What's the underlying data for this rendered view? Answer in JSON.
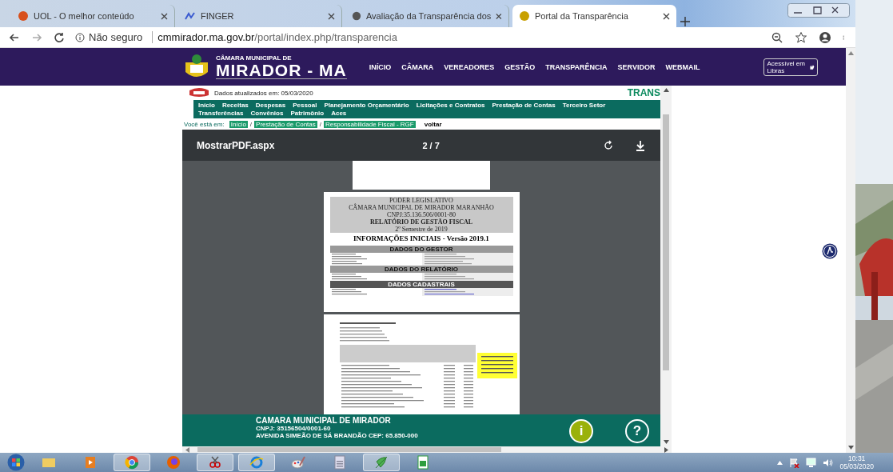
{
  "browser": {
    "tabs": [
      {
        "title": "UOL - O melhor conteúdo",
        "selected": false
      },
      {
        "title": "FINGER",
        "selected": false
      },
      {
        "title": "Avaliação da Transparência dos",
        "selected": false
      },
      {
        "title": "Portal da Transparência",
        "selected": true
      }
    ],
    "security": "Não seguro",
    "url_host": "cmmirador.ma.gov.br",
    "url_path": "/portal/index.php/transparencia"
  },
  "site": {
    "logo_top": "CÂMARA MUNICIPAL DE",
    "logo_main": "MIRADOR - MA",
    "menu": [
      "INÍCIO",
      "CÂMARA",
      "VEREADORES",
      "GESTÃO",
      "TRANSPARÊNCIA",
      "SERVIDOR",
      "WEBMAIL"
    ],
    "libras": "Acessível em Libras"
  },
  "portal": {
    "updated": "Dados atualizados em: 05/03/2020",
    "brand": "TRANS",
    "nav": [
      "Início",
      "Receitas",
      "Despesas",
      "Pessoal",
      "Planejamento Orçamentário",
      "Licitações e Contratos",
      "Prestação de Contas",
      "Terceiro Setor",
      "Transferências",
      "Convênios",
      "Patrimônio",
      "Aces"
    ],
    "breadcrumb_label": "Você está em:",
    "breadcrumb_separator": "/",
    "breadcrumb": [
      "Início",
      "Prestação de Contas",
      "Responsabilidade Fiscal - RGF"
    ],
    "back": "voltar"
  },
  "pdf": {
    "filename": "MostrarPDF.aspx",
    "page": "2 / 7",
    "report_header": [
      "PODER LEGISLATIVO",
      "CÂMARA MUNICIPAL DE MIRADOR MARANHÃO",
      "CNPJ:35.136.506/0001-80",
      "RELATÓRIO DE GESTÃO FISCAL",
      "2º Semestre de 2019"
    ],
    "report_title": "INFORMAÇÕES INICIAIS - Versão 2019.1",
    "sections": [
      "DADOS DO GESTOR",
      "DADOS DO RELATÓRIO",
      "DADOS CADASTRAIS"
    ]
  },
  "footer": {
    "title": "CAMARA MUNICIPAL DE MIRADOR",
    "cnpj": "CNPJ: 35156504/0001-60",
    "address": "AVENIDA SIMEÃO DE SÁ BRANDÃO CEP: 65.850-000",
    "buttons": [
      "i",
      "?"
    ]
  },
  "taskbar": {
    "time": "10:31",
    "date": "05/03/2020"
  }
}
